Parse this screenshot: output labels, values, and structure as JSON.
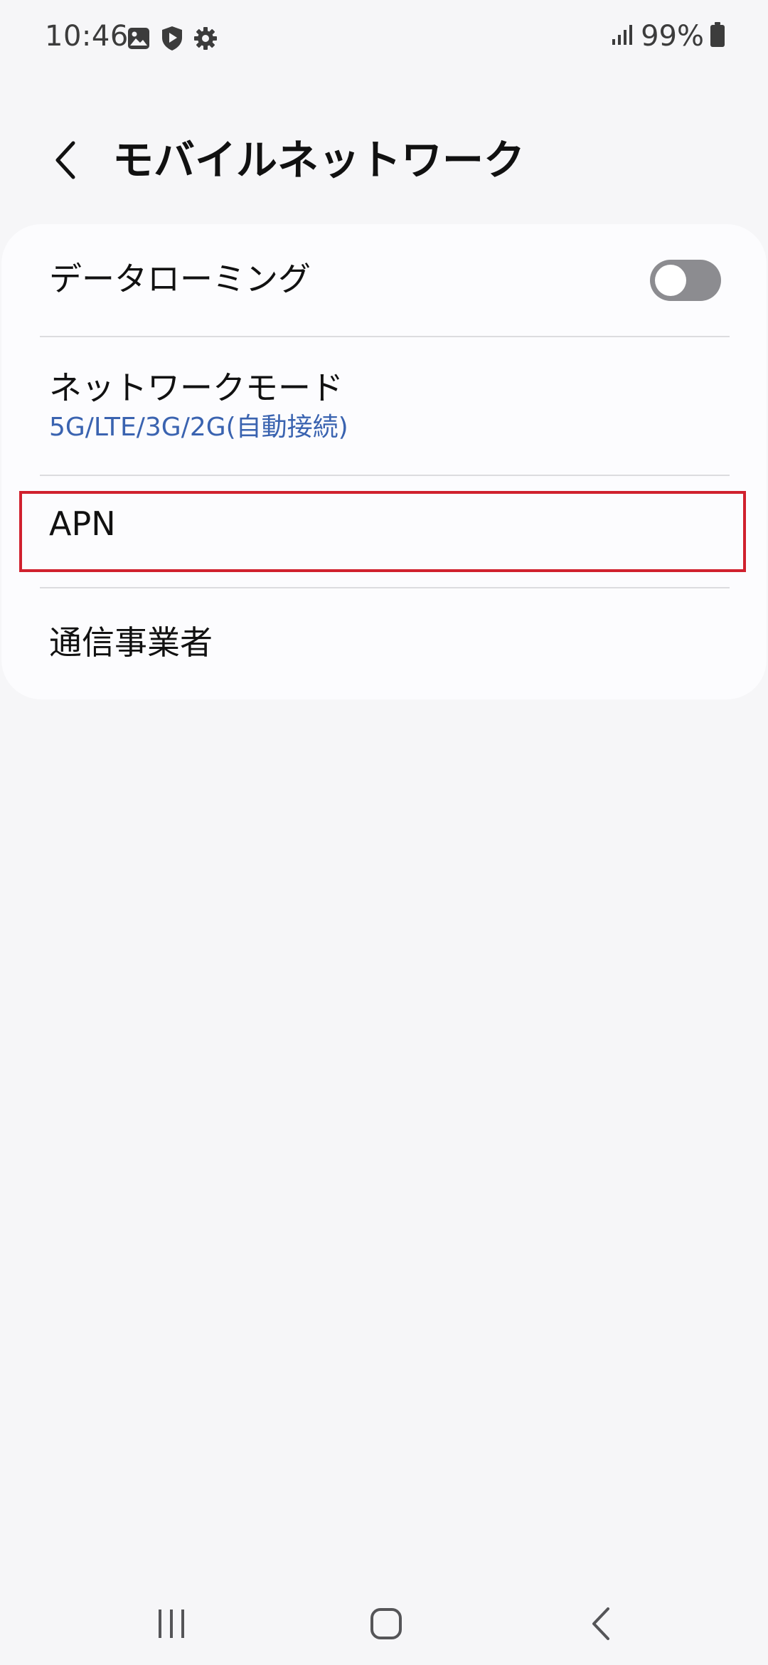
{
  "status_bar": {
    "time": "10:46",
    "battery": "99%",
    "icons": [
      "image-icon",
      "shield-play-icon",
      "gear-icon",
      "signal-icon",
      "battery-icon"
    ]
  },
  "header": {
    "title": "モバイルネットワーク",
    "back_icon": "chevron-left-icon"
  },
  "settings": {
    "data_roaming": {
      "label": "データローミング",
      "enabled": false
    },
    "network_mode": {
      "label": "ネットワークモード",
      "value": "5G/LTE/3G/2G(自動接続)"
    },
    "apn": {
      "label": "APN"
    },
    "carrier": {
      "label": "通信事業者"
    }
  },
  "nav_bar": {
    "buttons": [
      "recent-apps-icon",
      "home-icon",
      "back-icon"
    ]
  },
  "colors": {
    "background": "#f6f6f8",
    "card": "#fcfcfe",
    "accent": "#3a63b0",
    "highlight": "#d0212e",
    "toggle_off": "#8c8c90"
  }
}
